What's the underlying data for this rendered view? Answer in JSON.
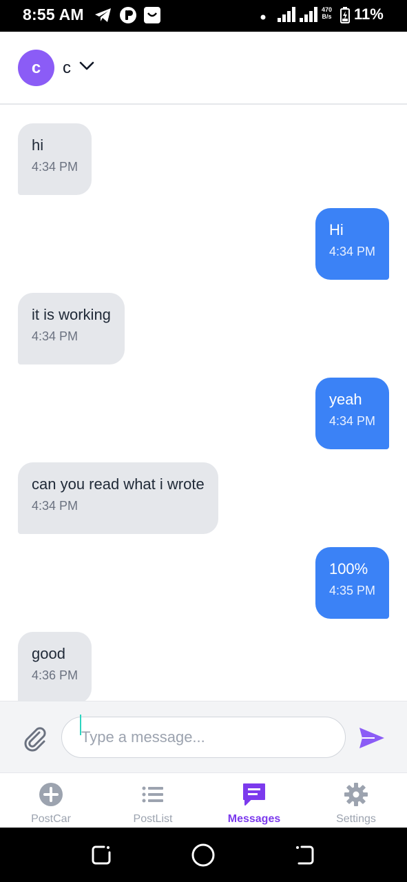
{
  "status_bar": {
    "time": "8:55 AM",
    "net_speed_value": "470",
    "net_speed_unit": "B/s",
    "battery": "11%",
    "icons": [
      "telegram-icon",
      "app-icon",
      "shopping-bag-icon",
      "dot-icon",
      "signal-icon",
      "signal-icon",
      "battery-icon"
    ]
  },
  "header": {
    "avatar_letter": "c",
    "contact_name": "c",
    "dropdown_icon": "chevron-down-icon",
    "avatar_color": "#8b5cf6"
  },
  "messages": [
    {
      "direction": "in",
      "text": "hi",
      "time": "4:34 PM"
    },
    {
      "direction": "out",
      "text": "Hi",
      "time": "4:34 PM"
    },
    {
      "direction": "in",
      "text": "it is working",
      "time": "4:34 PM"
    },
    {
      "direction": "out",
      "text": "yeah",
      "time": "4:34 PM"
    },
    {
      "direction": "in",
      "text": "can you read what i wrote",
      "time": "4:34 PM"
    },
    {
      "direction": "out",
      "text": "100%",
      "time": "4:35 PM"
    },
    {
      "direction": "in",
      "text": "good",
      "time": "4:36 PM"
    }
  ],
  "composer": {
    "placeholder": "Type a message...",
    "value": "",
    "attach_icon": "paperclip-icon",
    "send_icon": "send-icon"
  },
  "bottom_nav": {
    "items": [
      {
        "label": "PostCar",
        "icon": "plus-circle-icon",
        "active": false
      },
      {
        "label": "PostList",
        "icon": "list-icon",
        "active": false
      },
      {
        "label": "Messages",
        "icon": "message-icon",
        "active": true
      },
      {
        "label": "Settings",
        "icon": "gear-icon",
        "active": false
      }
    ]
  },
  "colors": {
    "incoming_bubble": "#e5e7eb",
    "outgoing_bubble": "#3b82f6",
    "accent": "#7c3aed",
    "inactive_nav": "#9ca3af"
  }
}
